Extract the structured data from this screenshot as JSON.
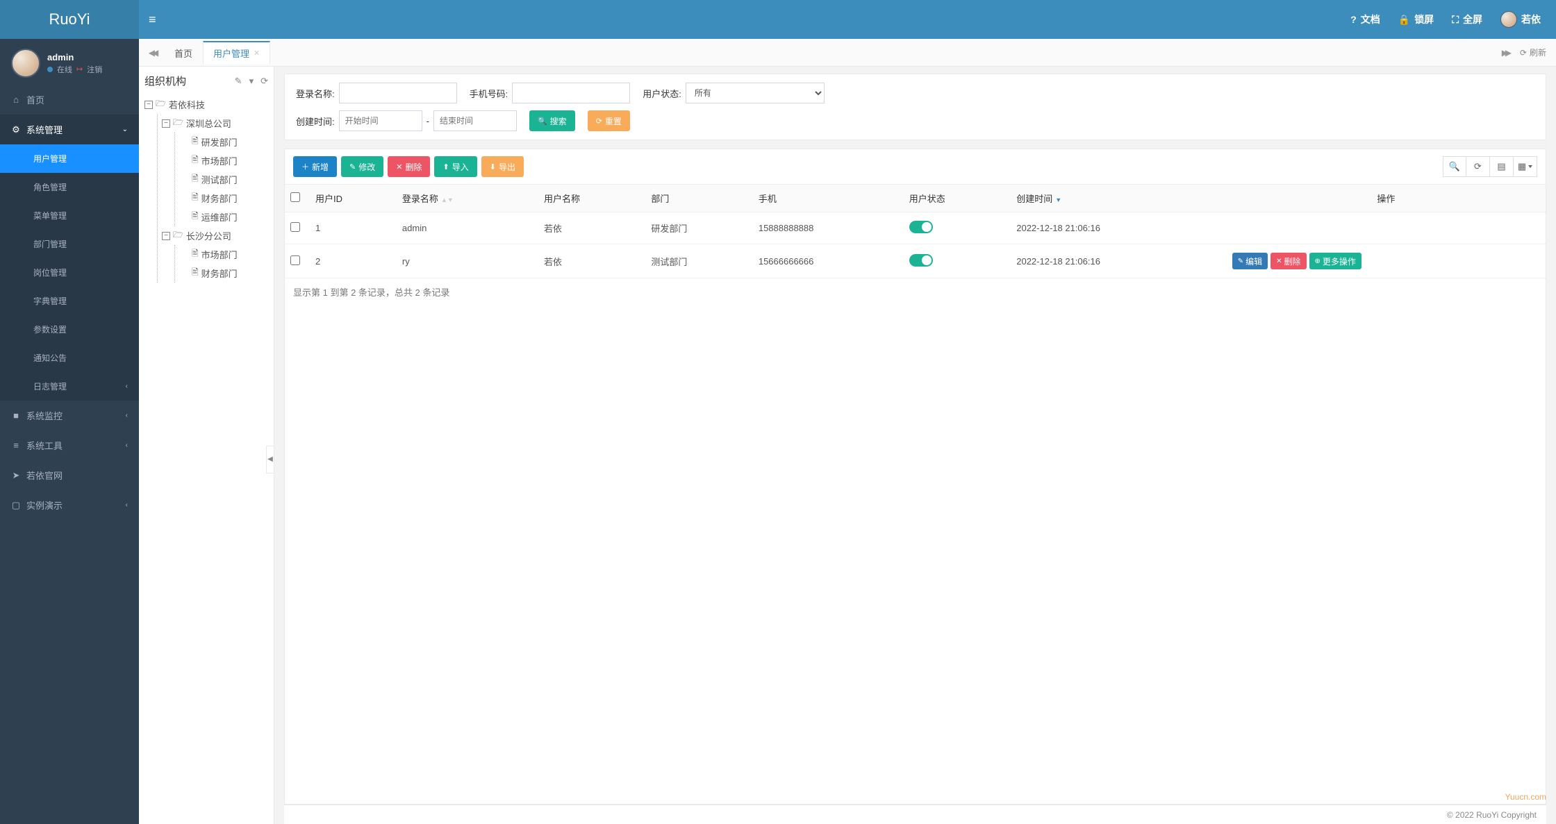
{
  "brand": "RuoYi",
  "user": {
    "name": "admin",
    "status": "在线",
    "logout": "注销"
  },
  "topbar": {
    "docs": "文档",
    "lock": "锁屏",
    "fullscreen": "全屏",
    "display_name": "若依"
  },
  "sidebar": {
    "home": "首页",
    "system": "系统管理",
    "items": [
      "用户管理",
      "角色管理",
      "菜单管理",
      "部门管理",
      "岗位管理",
      "字典管理",
      "参数设置",
      "通知公告",
      "日志管理"
    ],
    "monitor": "系统监控",
    "tools": "系统工具",
    "website": "若依官网",
    "demo": "实例演示"
  },
  "tabs": {
    "home": "首页",
    "active": "用户管理",
    "refresh": "刷新"
  },
  "tree": {
    "title": "组织机构",
    "root": "若依科技",
    "shenzhen": "深圳总公司",
    "sz_children": [
      "研发部门",
      "市场部门",
      "测试部门",
      "财务部门",
      "运维部门"
    ],
    "changsha": "长沙分公司",
    "cs_children": [
      "市场部门",
      "财务部门"
    ]
  },
  "search": {
    "login_label": "登录名称:",
    "phone_label": "手机号码:",
    "status_label": "用户状态:",
    "status_value": "所有",
    "time_label": "创建时间:",
    "start_ph": "开始时间",
    "end_ph": "结束时间",
    "dash": "-",
    "search_btn": "搜索",
    "reset_btn": "重置"
  },
  "toolbar": {
    "add": "新增",
    "edit": "修改",
    "delete": "删除",
    "import": "导入",
    "export": "导出"
  },
  "columns": {
    "user_id": "用户ID",
    "login_name": "登录名称",
    "user_name": "用户名称",
    "dept": "部门",
    "phone": "手机",
    "status": "用户状态",
    "create_time": "创建时间",
    "ops": "操作"
  },
  "rows": [
    {
      "id": "1",
      "login": "admin",
      "name": "若依",
      "dept": "研发部门",
      "phone": "15888888888",
      "time": "2022-12-18 21:06:16",
      "ops": false
    },
    {
      "id": "2",
      "login": "ry",
      "name": "若依",
      "dept": "测试部门",
      "phone": "15666666666",
      "time": "2022-12-18 21:06:16",
      "ops": true
    }
  ],
  "row_ops": {
    "edit": "编辑",
    "delete": "删除",
    "more": "更多操作"
  },
  "table_footer": "显示第 1 到第 2 条记录，总共 2 条记录",
  "page_footer": "© 2022 RuoYi Copyright",
  "watermark": "Yuucn.com"
}
